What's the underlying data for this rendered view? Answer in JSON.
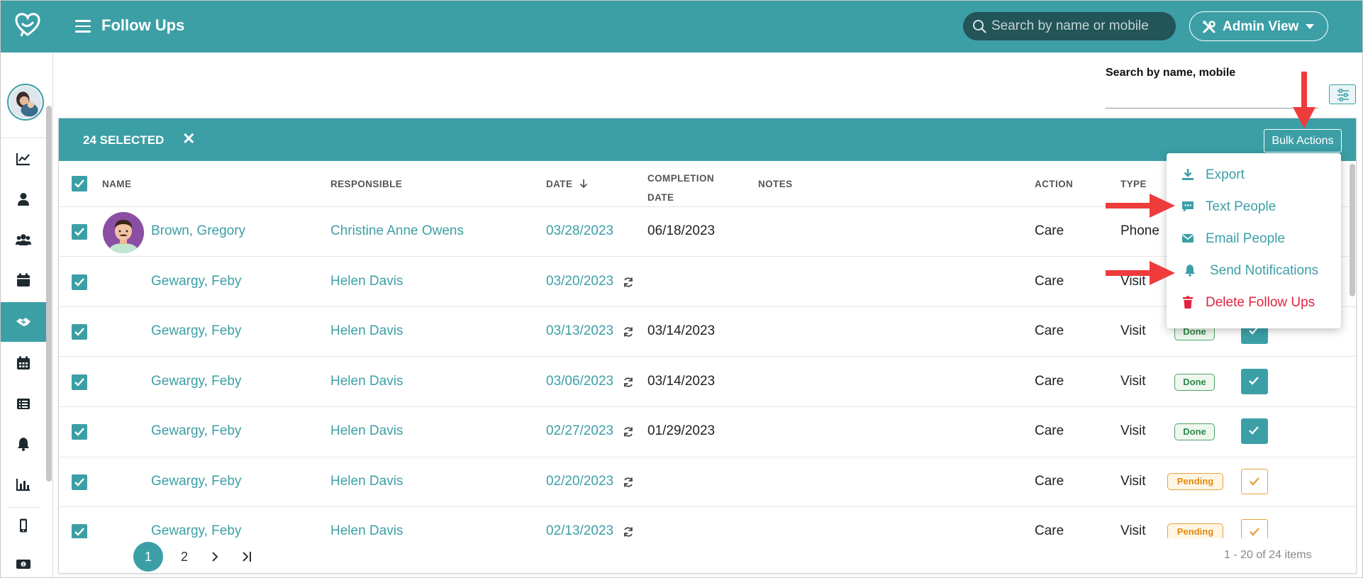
{
  "header": {
    "title": "Follow Ups",
    "search_placeholder": "Search by name or mobile",
    "view_button": "Admin View"
  },
  "filter": {
    "label": "Search by name, mobile"
  },
  "selection": {
    "count_label": "24 SELECTED",
    "clear_label": "✕",
    "bulk_actions": "Bulk Actions"
  },
  "table": {
    "columns": {
      "name": "NAME",
      "responsible": "RESPONSIBLE",
      "date": "DATE",
      "completion_line1": "COMPLETION",
      "completion_line2": "DATE",
      "notes": "NOTES",
      "action": "ACTION",
      "type": "TYPE"
    },
    "rows": [
      {
        "name": "Brown, Gregory",
        "responsible": "Christine Anne Owens",
        "date": "03/28/2023",
        "completion": "06/18/2023",
        "action": "Care",
        "type": "Phone",
        "status": "",
        "recurring": false
      },
      {
        "name": "Gewargy, Feby",
        "responsible": "Helen Davis",
        "date": "03/20/2023",
        "completion": "",
        "action": "Care",
        "type": "Visit",
        "status": "",
        "recurring": true
      },
      {
        "name": "Gewargy, Feby",
        "responsible": "Helen Davis",
        "date": "03/13/2023",
        "completion": "03/14/2023",
        "action": "Care",
        "type": "Visit",
        "status": "Done",
        "recurring": true
      },
      {
        "name": "Gewargy, Feby",
        "responsible": "Helen Davis",
        "date": "03/06/2023",
        "completion": "03/14/2023",
        "action": "Care",
        "type": "Visit",
        "status": "Done",
        "recurring": true
      },
      {
        "name": "Gewargy, Feby",
        "responsible": "Helen Davis",
        "date": "02/27/2023",
        "completion": "01/29/2023",
        "action": "Care",
        "type": "Visit",
        "status": "Done",
        "recurring": true
      },
      {
        "name": "Gewargy, Feby",
        "responsible": "Helen Davis",
        "date": "02/20/2023",
        "completion": "",
        "action": "Care",
        "type": "Visit",
        "status": "Pending",
        "recurring": true
      },
      {
        "name": "Gewargy, Feby",
        "responsible": "Helen Davis",
        "date": "02/13/2023",
        "completion": "",
        "action": "Care",
        "type": "Visit",
        "status": "Pending",
        "recurring": true
      }
    ]
  },
  "pagination": {
    "current": "1",
    "next_page": "2",
    "info": "1 - 20 of 24 items"
  },
  "bulk_menu": {
    "export": "Export",
    "text_people": "Text People",
    "email_people": "Email People",
    "send_notifications": "Send Notifications",
    "delete_follow_ups": "Delete Follow Ups"
  },
  "colors": {
    "primary": "#3c9fa6",
    "danger": "#e2233f",
    "done": "#2e8a4a",
    "pending": "#e08a10",
    "annotation_arrow": "#ef3b3b"
  },
  "icons": {
    "logo": "heart-chat-logo-icon",
    "sidebar": [
      "chart-line-icon",
      "user-icon",
      "users-icon",
      "calendar-icon",
      "handshake-icon",
      "calendar-grid-icon",
      "list-icon",
      "bell-icon",
      "bar-chart-icon",
      "mobile-icon",
      "money-icon"
    ]
  }
}
